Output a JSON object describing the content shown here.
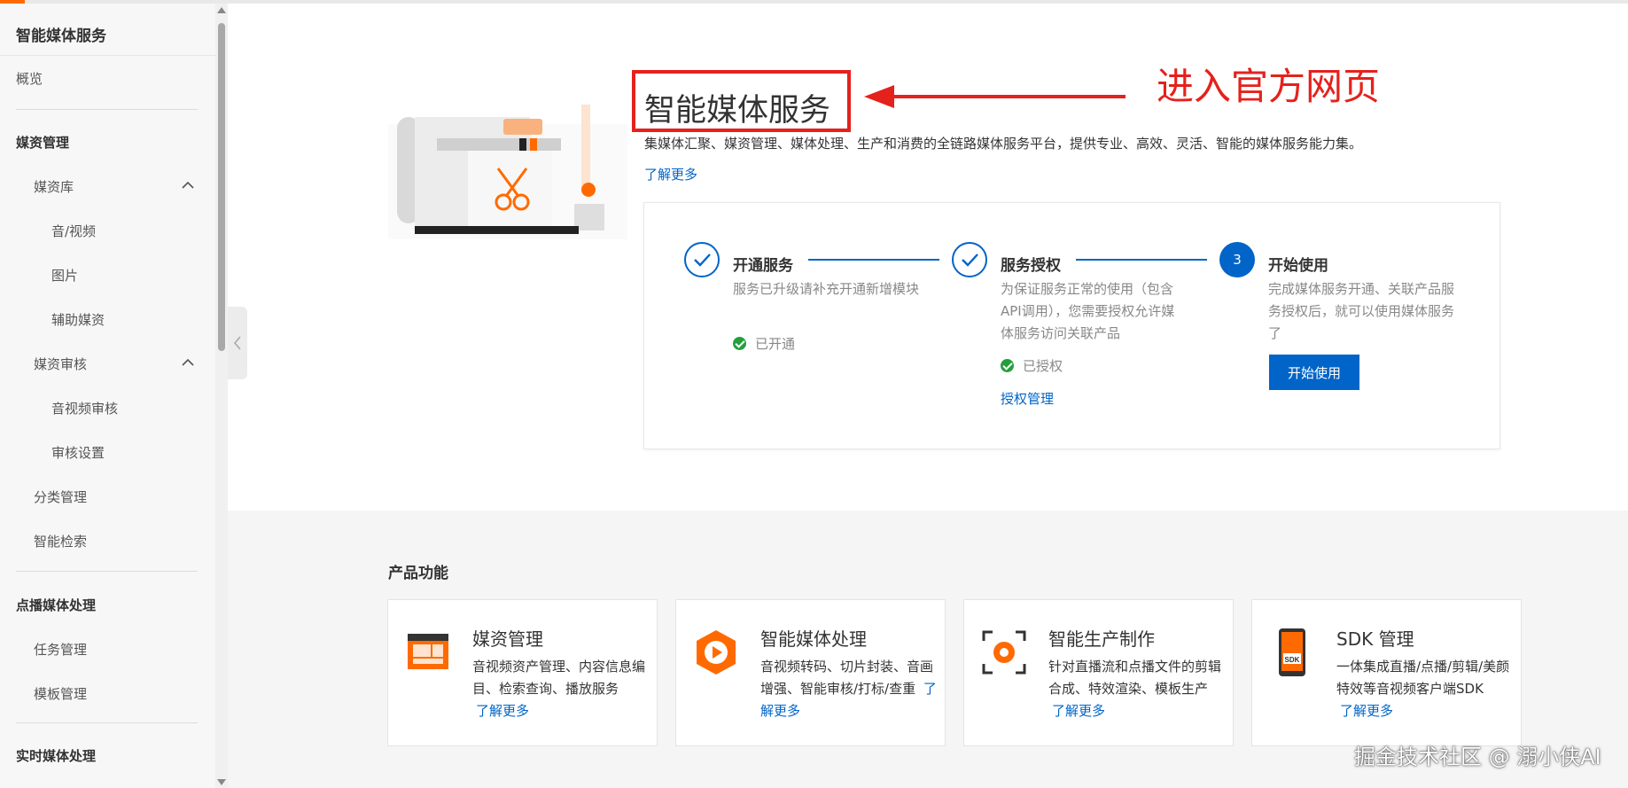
{
  "colors": {
    "brand": "#ff6a00",
    "primary": "#0064c8",
    "annotation_red": "#e5211c",
    "success": "#23a03c"
  },
  "sidebar": {
    "title": "智能媒体服务",
    "overview": "概览",
    "group_media_assets": "媒资管理",
    "media_library": "媒资库",
    "audio_video": "音/视频",
    "images": "图片",
    "aux_media": "辅助媒资",
    "media_review": "媒资审核",
    "av_review": "音视频审核",
    "review_settings": "审核设置",
    "category_mgmt": "分类管理",
    "smart_search": "智能检索",
    "group_vod": "点播媒体处理",
    "task_mgmt": "任务管理",
    "template_mgmt": "模板管理",
    "group_live": "实时媒体处理"
  },
  "hero": {
    "title": "智能媒体服务",
    "annotation": "进入官方网页",
    "description": "集媒体汇聚、媒资管理、媒体处理、生产和消费的全链路媒体服务平台，提供专业、高效、灵活、智能的媒体服务能力集。",
    "learn_more": "了解更多"
  },
  "steps": [
    {
      "title": "开通服务",
      "desc": "服务已升级请补充开通新增模块",
      "status": "已开通"
    },
    {
      "title": "服务授权",
      "desc": "为保证服务正常的使用（包含API调用），您需要授权允许媒体服务访问关联产品",
      "status": "已授权",
      "link": "授权管理"
    },
    {
      "number": "3",
      "title": "开始使用",
      "desc": "完成媒体服务开通、关联产品服务授权后，就可以使用媒体服务了",
      "button": "开始使用"
    }
  ],
  "products": {
    "section_title": "产品功能",
    "learn_more": "了解更多",
    "items": [
      {
        "title": "媒资管理",
        "desc": "音视频资产管理、内容信息编目、检索查询、播放服务",
        "icon": "media-asset-icon"
      },
      {
        "title": "智能媒体处理",
        "desc": "音视频转码、切片封装、音画增强、智能审核/打标/查重",
        "icon": "media-processing-icon"
      },
      {
        "title": "智能生产制作",
        "desc": "针对直播流和点播文件的剪辑合成、特效渲染、模板生产",
        "icon": "production-icon"
      },
      {
        "title": "SDK 管理",
        "desc": "一体集成直播/点播/剪辑/美颜特效等音视频客户端SDK",
        "icon": "sdk-icon",
        "icon_label": "SDK"
      }
    ]
  },
  "watermark": "掘金技术社区 @ 溺小侠AI"
}
